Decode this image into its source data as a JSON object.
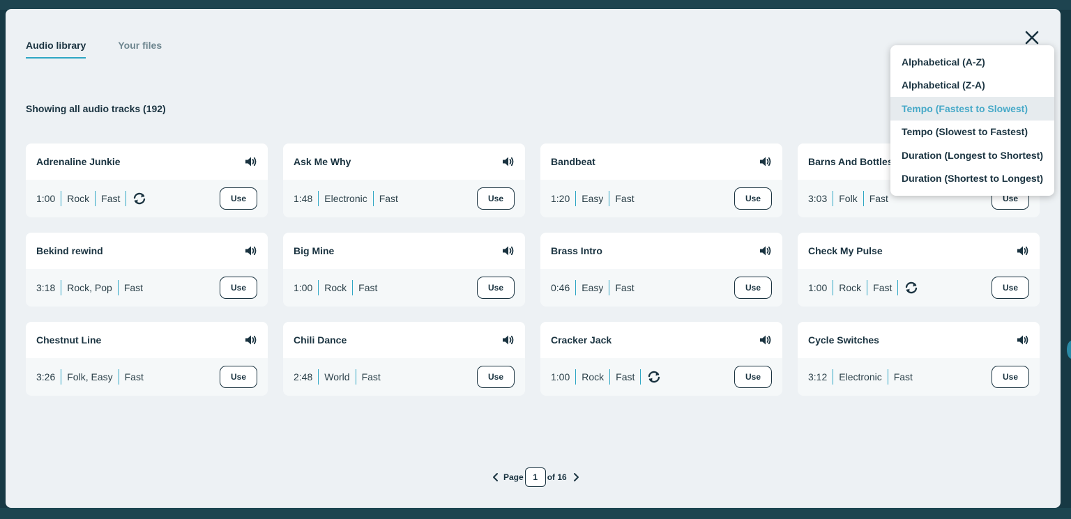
{
  "tabs": [
    {
      "label": "Audio library",
      "active": true
    },
    {
      "label": "Your files",
      "active": false
    }
  ],
  "heading": "Showing all audio tracks (192)",
  "sort_options": [
    {
      "label": "Alphabetical (A-Z)",
      "highlighted": false
    },
    {
      "label": "Alphabetical (Z-A)",
      "highlighted": false
    },
    {
      "label": "Tempo (Fastest to Slowest)",
      "highlighted": true
    },
    {
      "label": "Tempo (Slowest to Fastest)",
      "highlighted": false
    },
    {
      "label": "Duration (Longest to Shortest)",
      "highlighted": false
    },
    {
      "label": "Duration (Shortest to Longest)",
      "highlighted": false
    }
  ],
  "use_label": "Use",
  "tracks": [
    {
      "title": "Adrenaline Junkie",
      "duration": "1:00",
      "genre": "Rock",
      "tempo": "Fast",
      "loop": true
    },
    {
      "title": "Ask Me Why",
      "duration": "1:48",
      "genre": "Electronic",
      "tempo": "Fast",
      "loop": false
    },
    {
      "title": "Bandbeat",
      "duration": "1:20",
      "genre": "Easy",
      "tempo": "Fast",
      "loop": false
    },
    {
      "title": "Barns And Bottles",
      "duration": "3:03",
      "genre": "Folk",
      "tempo": "Fast",
      "loop": false
    },
    {
      "title": "Bekind rewind",
      "duration": "3:18",
      "genre": "Rock, Pop",
      "tempo": "Fast",
      "loop": false
    },
    {
      "title": "Big Mine",
      "duration": "1:00",
      "genre": "Rock",
      "tempo": "Fast",
      "loop": false
    },
    {
      "title": "Brass Intro",
      "duration": "0:46",
      "genre": "Easy",
      "tempo": "Fast",
      "loop": false
    },
    {
      "title": "Check My Pulse",
      "duration": "1:00",
      "genre": "Rock",
      "tempo": "Fast",
      "loop": true
    },
    {
      "title": "Chestnut Line",
      "duration": "3:26",
      "genre": "Folk, Easy",
      "tempo": "Fast",
      "loop": false
    },
    {
      "title": "Chili Dance",
      "duration": "2:48",
      "genre": "World",
      "tempo": "Fast",
      "loop": false
    },
    {
      "title": "Cracker Jack",
      "duration": "1:00",
      "genre": "Rock",
      "tempo": "Fast",
      "loop": true
    },
    {
      "title": "Cycle Switches",
      "duration": "3:12",
      "genre": "Electronic",
      "tempo": "Fast",
      "loop": false
    }
  ],
  "pagination": {
    "page_label": "Page",
    "current": "1",
    "of_label": "of 16"
  },
  "icons": {
    "close": "close-icon",
    "speaker": "speaker-icon",
    "loop": "loop-icon",
    "prev": "chevron-left-icon",
    "next": "chevron-right-icon"
  },
  "colors": {
    "accent": "#2ea6c4",
    "text": "#1a3340",
    "highlight_text": "#46a9c8",
    "modal_bg": "#edf1f4"
  }
}
